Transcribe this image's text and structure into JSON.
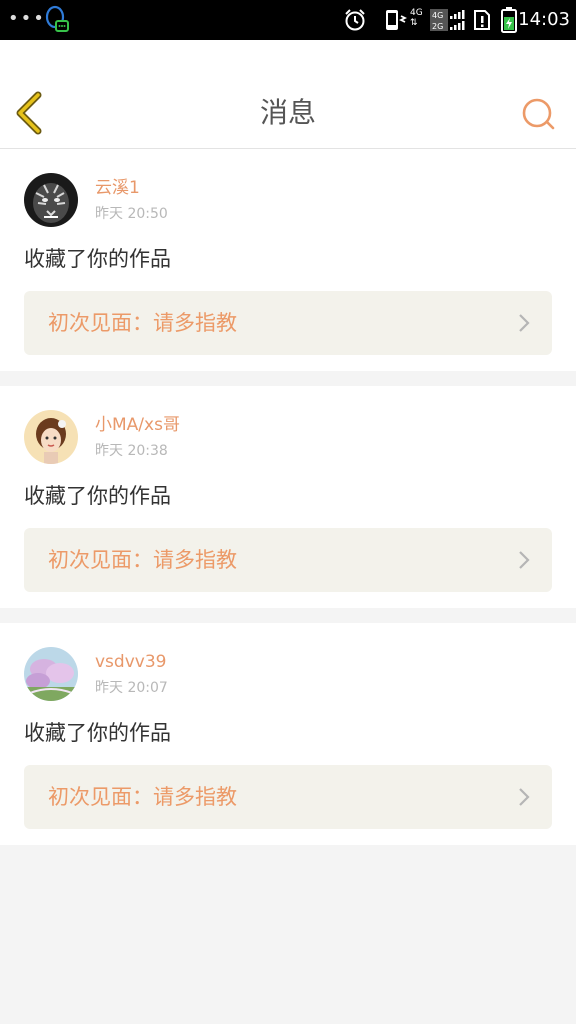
{
  "status_bar": {
    "time": "14:03",
    "network": "4G",
    "network2": "2G"
  },
  "header": {
    "title": "消息"
  },
  "messages": [
    {
      "user": "云溪1",
      "time": "昨天 20:50",
      "action": "收藏了你的作品",
      "quote": "初次见面：请多指教",
      "avatar": "tiger-avatar"
    },
    {
      "user": "小MA/xs哥",
      "time": "昨天 20:38",
      "action": "收藏了你的作品",
      "quote": "初次见面：请多指教",
      "avatar": "girl-avatar"
    },
    {
      "user": "vsdvv39",
      "time": "昨天 20:07",
      "action": "收藏了你的作品",
      "quote": "初次见面：请多指教",
      "avatar": "landscape-avatar"
    }
  ],
  "colors": {
    "accent": "#ec9a68",
    "back_icon": "#c8a800",
    "quote_bg": "#f3f2eb",
    "page_bg": "#f4f4f4"
  }
}
